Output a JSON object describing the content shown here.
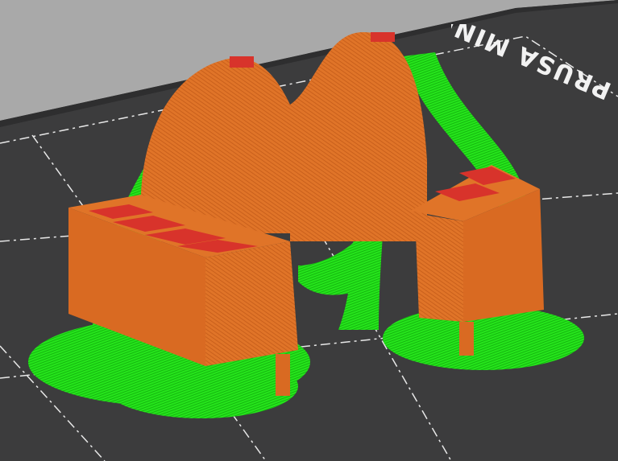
{
  "viewport": {
    "bed_label": "PRUSA MINI",
    "colors": {
      "background": "#a9a9a9",
      "bed": "#3c3c3d",
      "grid": "#e8e8e8",
      "perimeter": "#e07428",
      "top_infill": "#d8332b",
      "support": "#22e01a"
    }
  }
}
